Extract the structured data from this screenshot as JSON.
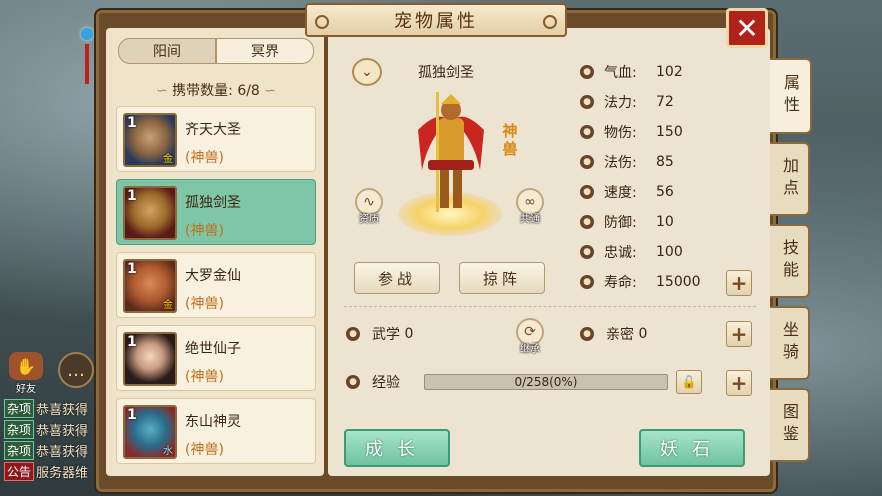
{
  "title": "宠物属性",
  "close_label": "✕",
  "realm_tabs": [
    {
      "label": "阳间",
      "active": true
    },
    {
      "label": "冥界",
      "active": false
    }
  ],
  "carry": {
    "label": "携带数量:",
    "value": "6/8"
  },
  "pets": [
    {
      "name": "齐天大圣",
      "type": "(神兽)",
      "level": "1",
      "grade": "金",
      "active": false
    },
    {
      "name": "孤独剑圣",
      "type": "(神兽)",
      "level": "1",
      "grade": "",
      "active": true
    },
    {
      "name": "大罗金仙",
      "type": "(神兽)",
      "level": "1",
      "grade": "金",
      "active": false
    },
    {
      "name": "绝世仙子",
      "type": "(神兽)",
      "level": "1",
      "grade": "",
      "active": false
    },
    {
      "name": "东山神灵",
      "type": "(神兽)",
      "level": "1",
      "grade": "水",
      "active": false
    }
  ],
  "selected_pet": {
    "name": "孤独剑圣",
    "tag": "神兽"
  },
  "side_icons": {
    "aptitude": "资质",
    "shared": "共通",
    "inherit": "继承"
  },
  "buttons": {
    "battle": "参战",
    "raid": "掠阵",
    "grow": "成长",
    "demon_stone": "妖石"
  },
  "stats": [
    {
      "label": "气血:",
      "value": "102",
      "icon": "blood-icon"
    },
    {
      "label": "法力:",
      "value": "72",
      "icon": "mana-icon"
    },
    {
      "label": "物伤:",
      "value": "150",
      "icon": "sword-icon"
    },
    {
      "label": "法伤:",
      "value": "85",
      "icon": "flame-icon"
    },
    {
      "label": "速度:",
      "value": "56",
      "icon": "speed-icon"
    },
    {
      "label": "防御:",
      "value": "10",
      "icon": "shield-icon"
    },
    {
      "label": "忠诚:",
      "value": "100",
      "icon": "loyalty-icon"
    },
    {
      "label": "寿命:",
      "value": "15000",
      "icon": "lifespan-icon"
    }
  ],
  "martial": {
    "label": "武学",
    "value": "0"
  },
  "intimacy": {
    "label": "亲密",
    "value": "0"
  },
  "experience": {
    "label": "经验",
    "text": "0/258(0%)",
    "progress": 0
  },
  "side_tabs": [
    {
      "label": "属性",
      "active": true
    },
    {
      "label": "加点",
      "active": false
    },
    {
      "label": "技能",
      "active": false
    },
    {
      "label": "坐骑",
      "active": false
    },
    {
      "label": "图鉴",
      "active": false
    }
  ],
  "hud": {
    "friend_label": "好友"
  },
  "chat": [
    {
      "tag": "杂项",
      "text": "恭喜获得",
      "alert": false
    },
    {
      "tag": "杂项",
      "text": "恭喜获得",
      "alert": false
    },
    {
      "tag": "杂项",
      "text": "恭喜获得",
      "alert": false
    },
    {
      "tag": "公告",
      "text": "服务器维",
      "alert": true
    }
  ],
  "colors": {
    "accent_green": "#7fc6a8",
    "close_red": "#b1221b",
    "divine_orange": "#d68a10"
  }
}
